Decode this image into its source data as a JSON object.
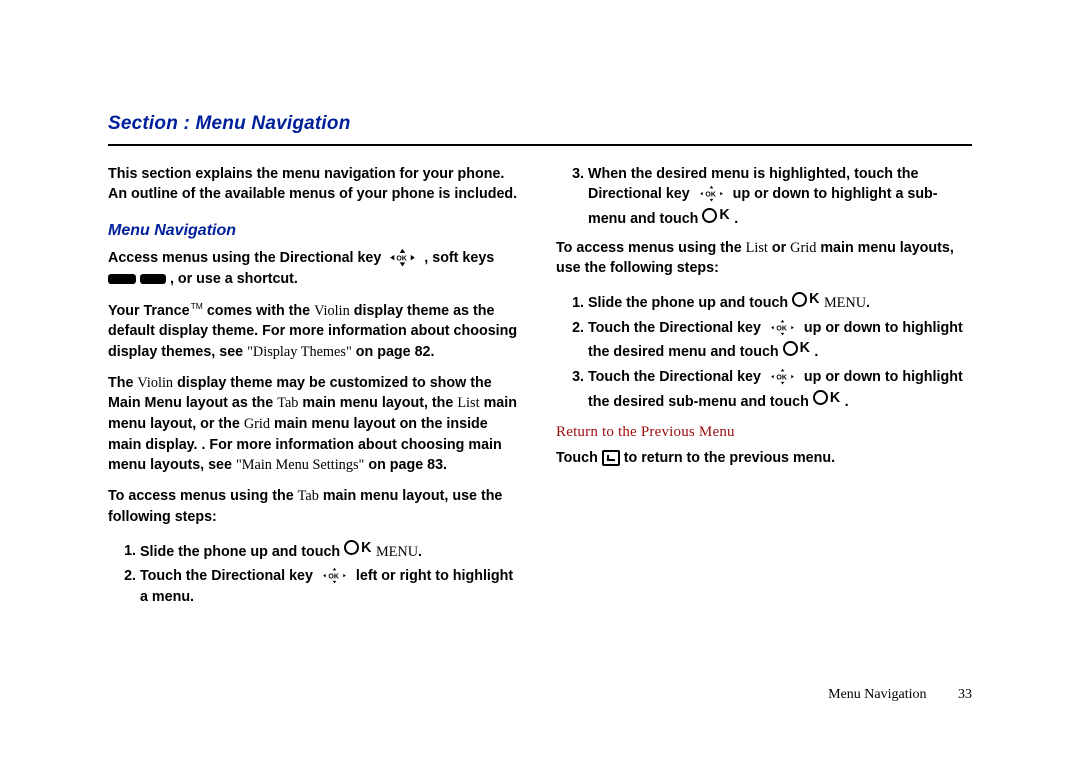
{
  "section_title": "Section : Menu Navigation",
  "intro": "This section explains the menu navigation for your phone. An outline of the available menus of your phone is included.",
  "heading_menu_nav": "Menu Navigation",
  "left": {
    "p1_a": "Access menus using the Directional key ",
    "p1_b": ", soft keys ",
    "p1_c": ", or use a shortcut.",
    "p2_a": "Your Trance",
    "tm": "TM",
    "p2_b": " comes with the ",
    "p2_c": " display theme as the default display theme. For more information about choosing display themes, see ",
    "ref1": "\"Display Themes\"",
    "p2_d": " on page 82.",
    "violin": "Violin",
    "p3_a": "The ",
    "p3_b": " display theme may be customized to show the Main Menu layout as the ",
    "tab": "Tab",
    "p3_c": " main menu layout, the ",
    "list": "List",
    "p3_d": " main menu layout, or the ",
    "grid": "Grid",
    "p3_e": " main menu layout on the inside main display. . For more information about choosing main menu layouts, see ",
    "ref2": "\"Main Menu Settings\"",
    "p3_f": " on page 83.",
    "p4_a": "To access menus using the ",
    "p4_b": " main menu layout, use the following steps:",
    "li1_a": "Slide the phone up and touch ",
    "li1_menu": "MENU",
    "li2_a": "Touch the Directional key ",
    "li2_b": " left or right to highlight a menu."
  },
  "right": {
    "li3_a": "When the desired menu is highlighted, touch the Directional key ",
    "li3_b": " up or down to highlight a sub-menu and touch ",
    "p5_a": "To access menus using the ",
    "p5_b": " or ",
    "p5_c": " main menu layouts, use the following steps:",
    "li1_a": "Slide the phone up and touch ",
    "li1_menu": "MENU",
    "li2_a": "Touch the Directional key ",
    "li2_b": " up or down to highlight the desired menu and touch ",
    "li3r_a": "Touch the Directional key ",
    "li3r_b": " up or down to highlight the desired sub-menu and touch ",
    "subhead": "Return to the Previous Menu",
    "back_a": "Touch ",
    "back_b": " to return to the previous menu."
  },
  "footer_label": "Menu Navigation",
  "footer_page": "33"
}
